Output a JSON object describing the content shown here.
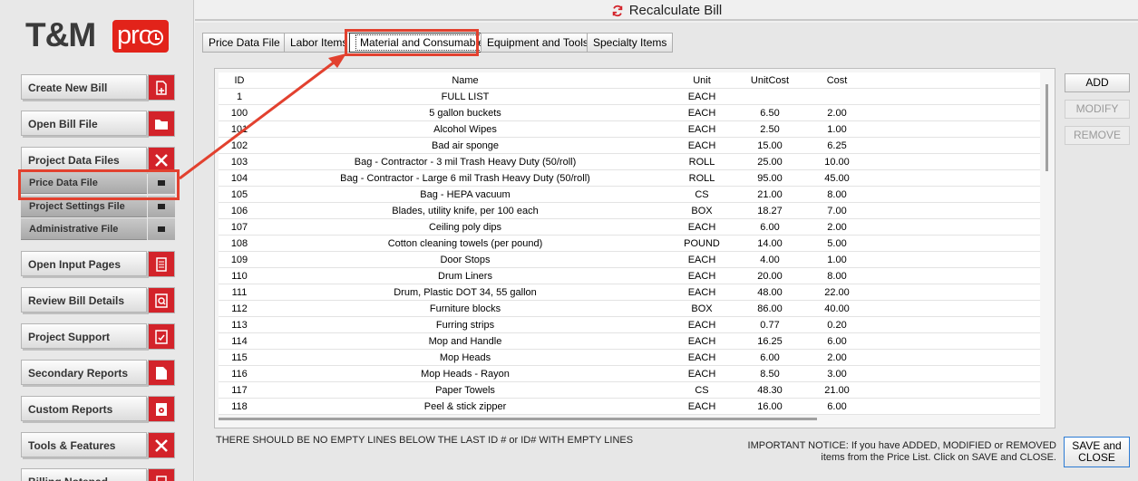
{
  "window": {
    "title": "Recalculate Bill"
  },
  "logo": {
    "brand": "T&M",
    "suffix": "pro"
  },
  "sidebar": {
    "items": [
      {
        "label": "Create New Bill",
        "icon": "new-file-icon"
      },
      {
        "label": "Open Bill File",
        "icon": "folder-icon"
      },
      {
        "label": "Project Data Files",
        "icon": "close-x-icon"
      },
      {
        "label": "Open Input Pages",
        "icon": "page-icon"
      },
      {
        "label": "Review Bill Details",
        "icon": "magnify-document-icon"
      },
      {
        "label": "Project Support",
        "icon": "checklist-icon"
      },
      {
        "label": "Secondary Reports",
        "icon": "report-icon"
      },
      {
        "label": "Custom Reports",
        "icon": "gear-document-icon"
      },
      {
        "label": "Tools & Features",
        "icon": "tools-icon"
      },
      {
        "label": "Billing Notepad",
        "icon": "notepad-icon"
      }
    ],
    "subitems": [
      {
        "label": "Price Data File"
      },
      {
        "label": "Project Settings File"
      },
      {
        "label": "Administrative File"
      }
    ]
  },
  "tabs": [
    {
      "label": "Price Data File"
    },
    {
      "label": "Labor Items"
    },
    {
      "label": "Material and Consumable"
    },
    {
      "label": "Equipment and Tools"
    },
    {
      "label": "Specialty Items"
    }
  ],
  "table": {
    "columns": [
      "ID",
      "Name",
      "Unit",
      "UnitCost",
      "Cost"
    ],
    "rows": [
      [
        "1",
        "FULL LIST",
        "EACH",
        "",
        ""
      ],
      [
        "100",
        "5 gallon buckets",
        "EACH",
        "6.50",
        "2.00"
      ],
      [
        "101",
        "Alcohol Wipes",
        "EACH",
        "2.50",
        "1.00"
      ],
      [
        "102",
        "Bad air sponge",
        "EACH",
        "15.00",
        "6.25"
      ],
      [
        "103",
        "Bag - Contractor - 3 mil Trash Heavy Duty (50/roll)",
        "ROLL",
        "25.00",
        "10.00"
      ],
      [
        "104",
        "Bag - Contractor - Large 6 mil Trash Heavy Duty (50/roll)",
        "ROLL",
        "95.00",
        "45.00"
      ],
      [
        "105",
        "Bag - HEPA vacuum",
        "CS",
        "21.00",
        "8.00"
      ],
      [
        "106",
        "Blades, utility knife, per 100 each",
        "BOX",
        "18.27",
        "7.00"
      ],
      [
        "107",
        "Ceiling poly dips",
        "EACH",
        "6.00",
        "2.00"
      ],
      [
        "108",
        "Cotton cleaning towels (per pound)",
        "POUND",
        "14.00",
        "5.00"
      ],
      [
        "109",
        "Door Stops",
        "EACH",
        "4.00",
        "1.00"
      ],
      [
        "110",
        "Drum Liners",
        "EACH",
        "20.00",
        "8.00"
      ],
      [
        "111",
        "Drum, Plastic DOT 34, 55 gallon",
        "EACH",
        "48.00",
        "22.00"
      ],
      [
        "112",
        "Furniture blocks",
        "BOX",
        "86.00",
        "40.00"
      ],
      [
        "113",
        "Furring strips",
        "EACH",
        "0.77",
        "0.20"
      ],
      [
        "114",
        "Mop  and Handle",
        "EACH",
        "16.25",
        "6.00"
      ],
      [
        "115",
        "Mop Heads",
        "EACH",
        "6.00",
        "2.00"
      ],
      [
        "116",
        "Mop Heads - Rayon",
        "EACH",
        "8.50",
        "3.00"
      ],
      [
        "117",
        "Paper Towels",
        "CS",
        "48.30",
        "21.00"
      ],
      [
        "118",
        "Peel & stick zipper",
        "EACH",
        "16.00",
        "6.00"
      ]
    ]
  },
  "actions": {
    "add": "ADD",
    "modify": "MODIFY",
    "remove": "REMOVE",
    "save_line1": "SAVE and",
    "save_line2": "CLOSE"
  },
  "warning": "THERE SHOULD BE NO EMPTY LINES BELOW THE LAST ID # or ID# WITH EMPTY LINES",
  "notice_line1": "IMPORTANT NOTICE:  If you have ADDED, MODIFIED or REMOVED",
  "notice_line2": "items from the Price List.  Click on SAVE and CLOSE.",
  "colors": {
    "accent": "#d3232a",
    "annotation": "#e2412f",
    "focus": "#2a7ad4"
  }
}
